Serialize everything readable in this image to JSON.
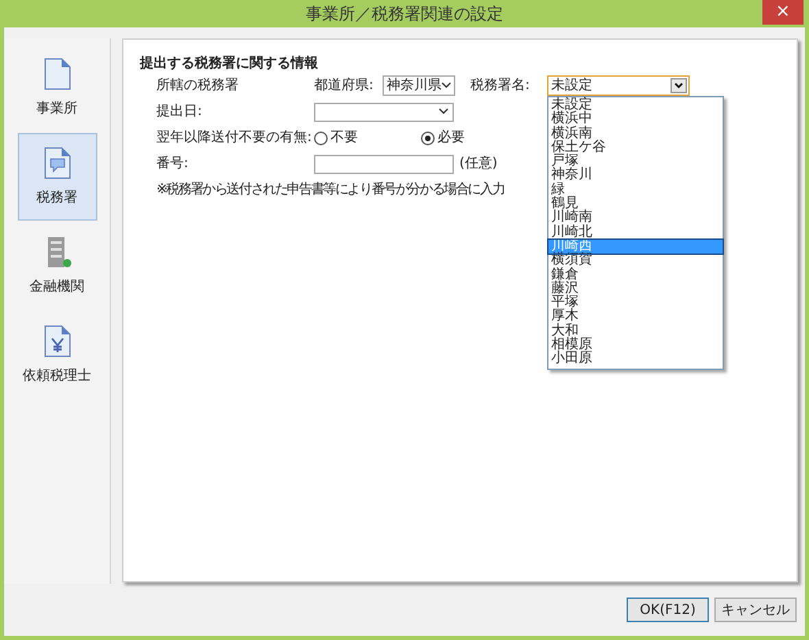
{
  "window": {
    "title": "事業所／税務署関連の設定",
    "close": "×"
  },
  "sidebar": {
    "items": [
      {
        "label": "事業所",
        "kind": "document",
        "selected": false
      },
      {
        "label": "税務署",
        "kind": "message",
        "selected": true
      },
      {
        "label": "金融機関",
        "kind": "building",
        "selected": false
      },
      {
        "label": "依頼税理士",
        "kind": "yen",
        "selected": false
      }
    ]
  },
  "form": {
    "heading": "提出する税務署に関する情報",
    "office_row": {
      "label": "所轄の税務署",
      "prefecture_label": "都道府県:",
      "prefecture_value": "神奈川県",
      "office_label": "税務署名:",
      "office_value": "未設定",
      "expanded": true,
      "options": [
        {
          "label": "未設定",
          "selected": false
        },
        {
          "label": "横浜中",
          "selected": false
        },
        {
          "label": "横浜南",
          "selected": false
        },
        {
          "label": "保土ケ谷",
          "selected": false
        },
        {
          "label": "戸塚",
          "selected": false
        },
        {
          "label": "神奈川",
          "selected": false
        },
        {
          "label": "緑",
          "selected": false
        },
        {
          "label": "鶴見",
          "selected": false
        },
        {
          "label": "川崎南",
          "selected": false
        },
        {
          "label": "川崎北",
          "selected": false
        },
        {
          "label": "川崎西",
          "selected": true
        },
        {
          "label": "横須賀",
          "selected": false
        },
        {
          "label": "鎌倉",
          "selected": false
        },
        {
          "label": "藤沢",
          "selected": false
        },
        {
          "label": "平塚",
          "selected": false
        },
        {
          "label": "厚木",
          "selected": false
        },
        {
          "label": "大和",
          "selected": false
        },
        {
          "label": "相模原",
          "selected": false
        },
        {
          "label": "小田原",
          "selected": false
        }
      ]
    },
    "date_row": {
      "label": "提出日:"
    },
    "radio_row": {
      "label": "翌年以降送付不要の有無:",
      "options": [
        {
          "label": "不要",
          "selected": false
        },
        {
          "label": "必要",
          "selected": true
        }
      ]
    },
    "number_row": {
      "label": "番号:",
      "hint": "(任意)"
    },
    "note": "※税務署から送付された申告書等により番号が分かる場合に入力"
  },
  "buttons": [
    "OK(F12)",
    "キャンセル"
  ]
}
